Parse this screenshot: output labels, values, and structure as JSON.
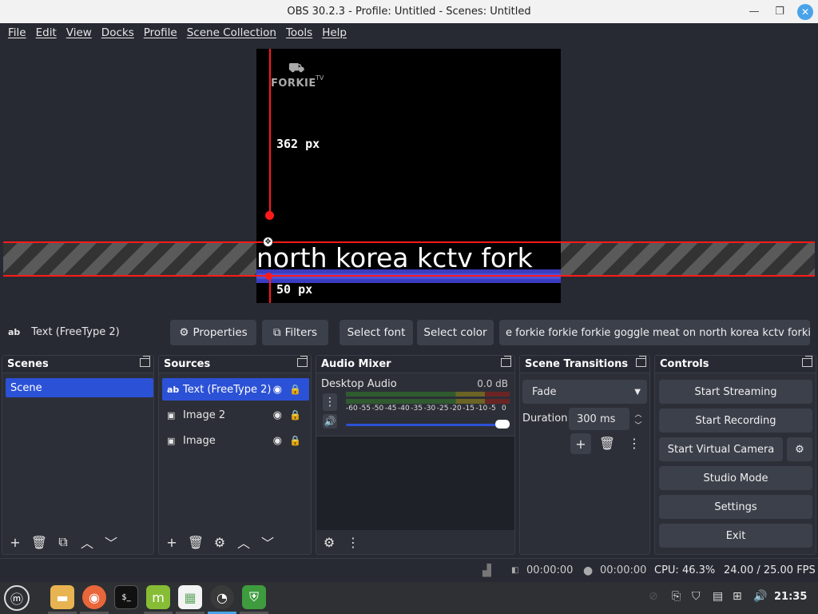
{
  "window": {
    "title": "OBS 30.2.3 - Profile: Untitled - Scenes: Untitled"
  },
  "menu": [
    "File",
    "Edit",
    "View",
    "Docks",
    "Profile",
    "Scene Collection",
    "Tools",
    "Help"
  ],
  "preview": {
    "logo_text": "FORKIE",
    "logo_sup": "TV",
    "measure_top": "362 px",
    "measure_bottom": "50 px",
    "marquee_text": "north korea kctv fork"
  },
  "source_toolbar": {
    "source_name": "Text (FreeType 2)",
    "properties": "Properties",
    "filters": "Filters",
    "select_font": "Select font",
    "select_color": "Select color",
    "text_value": "e forkie forkie forkie goggle meat on north korea kctv forkie tv"
  },
  "scenes": {
    "title": "Scenes",
    "items": [
      "Scene"
    ]
  },
  "sources": {
    "title": "Sources",
    "items": [
      "Text (FreeType 2)",
      "Image 2",
      "Image"
    ]
  },
  "audio": {
    "title": "Audio Mixer",
    "channel": "Desktop Audio",
    "level": "0.0 dB",
    "scale": [
      "-60",
      "-55",
      "-50",
      "-45",
      "-40",
      "-35",
      "-30",
      "-25",
      "-20",
      "-15",
      "-10",
      "-5",
      "0"
    ],
    "volume_fraction": 1.0
  },
  "transitions": {
    "title": "Scene Transitions",
    "selected": "Fade",
    "duration_label": "Duration",
    "duration_value": "300 ms"
  },
  "controls": {
    "title": "Controls",
    "start_streaming": "Start Streaming",
    "start_recording": "Start Recording",
    "start_virtual_camera": "Start Virtual Camera",
    "studio_mode": "Studio Mode",
    "settings": "Settings",
    "exit": "Exit"
  },
  "status": {
    "stream_time": "00:00:00",
    "record_time": "00:00:00",
    "cpu": "CPU: 46.3%",
    "fps": "24.00 / 25.00 FPS"
  },
  "taskbar": {
    "clock": "21:35"
  },
  "colors": {
    "accent": "#2b51d6",
    "guide_red": "#ff1a1a",
    "band_blue": "#3a3dbf"
  }
}
